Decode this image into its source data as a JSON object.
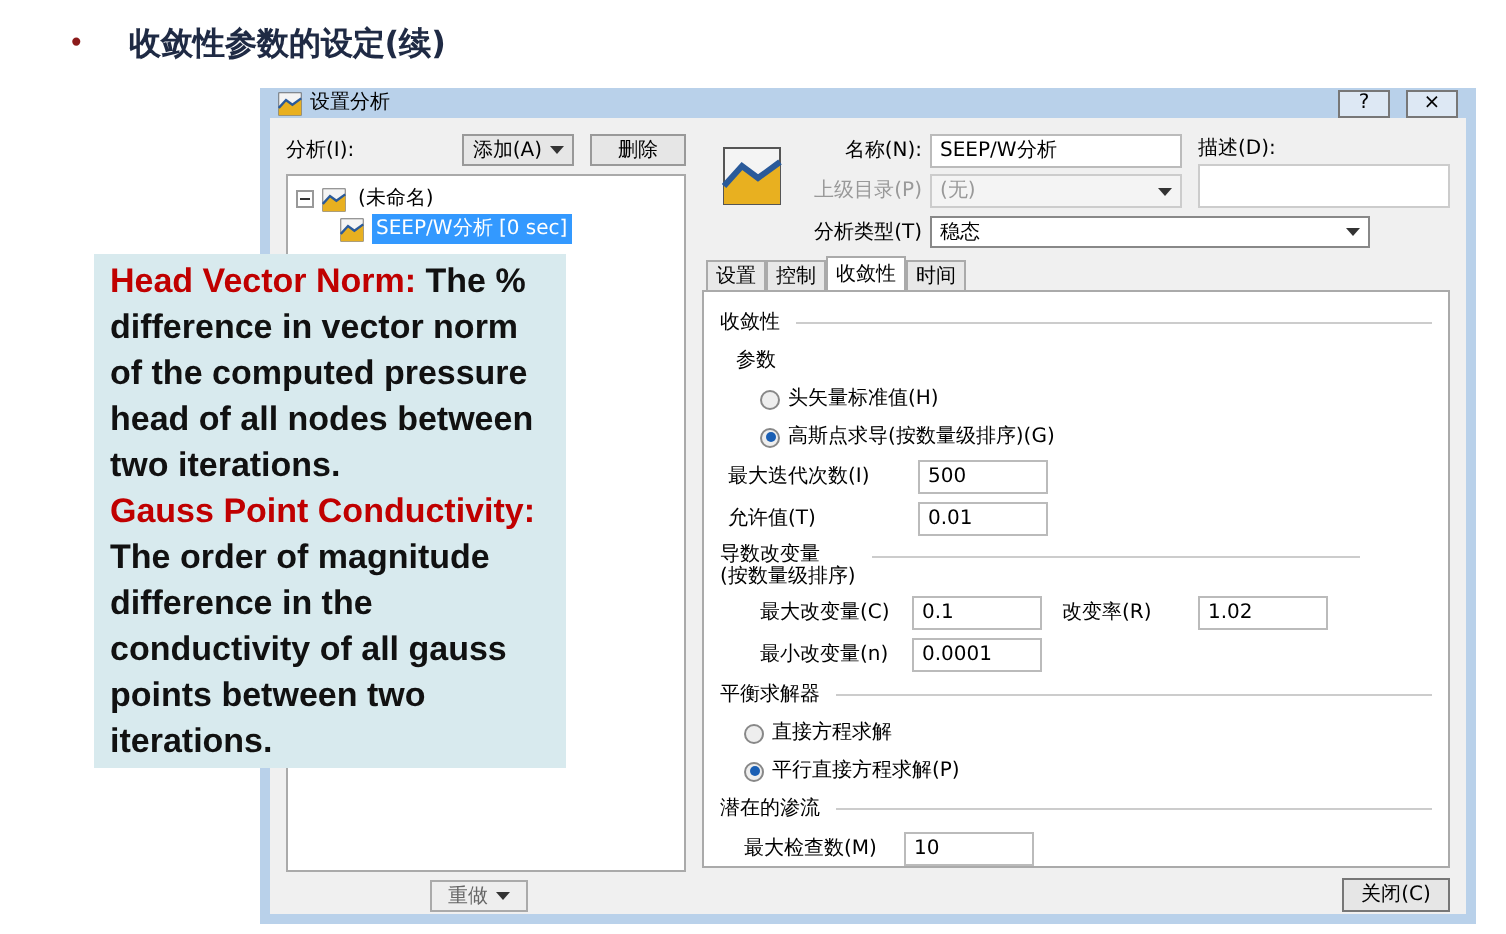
{
  "slide_title": {
    "bullet": "•",
    "text": "收敛性参数的设定(续)"
  },
  "dialog": {
    "title": "设置分析",
    "title_buttons": [
      "?",
      "×"
    ],
    "left": {
      "label": "分析(I):",
      "add_button": "添加(A)",
      "delete_button": "删除",
      "tree": [
        {
          "label": "(未命名)",
          "expanded": true,
          "selected": false,
          "children": [
            {
              "label": "SEEP/W分析 [0 sec]",
              "selected": true
            }
          ]
        }
      ],
      "bottom_button": "重做"
    },
    "name_field": {
      "label": "名称(N):",
      "value": "SEEP/W分析"
    },
    "parent_field": {
      "label": "上级目录(P)",
      "value": "(无)",
      "disabled": true
    },
    "description_field": {
      "label": "描述(D):"
    },
    "type_field": {
      "label": "分析类型(T)",
      "value": "稳态"
    },
    "tabs": [
      {
        "label": "设置",
        "selected": false
      },
      {
        "label": "控制",
        "selected": false
      },
      {
        "label": "收敛性",
        "selected": true
      },
      {
        "label": "时间",
        "selected": false
      }
    ],
    "convergence": {
      "heading": "收敛性",
      "params_heading": "参数",
      "radios": [
        {
          "label": "头矢量标准值(H)",
          "selected": false
        },
        {
          "label": "高斯点求导(按数量级排序)(G)",
          "selected": true
        }
      ],
      "fields": [
        {
          "label": "最大迭代次数(I)",
          "value": "500"
        },
        {
          "label": "允许值(T)",
          "value": "0.01"
        }
      ]
    },
    "change": {
      "heading": [
        "导数改变量",
        "(按数量级排序)"
      ],
      "max": {
        "label": "最大改变量(C)",
        "value": "0.1"
      },
      "rate": {
        "label": "改变率(R)",
        "value": "1.02"
      },
      "min": {
        "label": "最小改变量(n)",
        "value": "0.0001"
      }
    },
    "solver": {
      "heading": "平衡求解器",
      "radios": [
        {
          "label": "直接方程求解",
          "selected": false
        },
        {
          "label": "平行直接方程求解(P)",
          "selected": true
        }
      ]
    },
    "seepage": {
      "heading": "潜在的渗流",
      "field": {
        "label": "最大检查数(M)",
        "value": "10"
      }
    },
    "close_button": "关闭(C)"
  },
  "callout": [
    {
      "term": "Head Vector Norm:",
      "text": "The % difference in vector norm of the computed pressure head of all nodes between two iterations."
    },
    {
      "term": "Gauss Point Conductivity:",
      "text": "The order of magnitude difference in the conductivity of all gauss points between two iterations."
    }
  ]
}
